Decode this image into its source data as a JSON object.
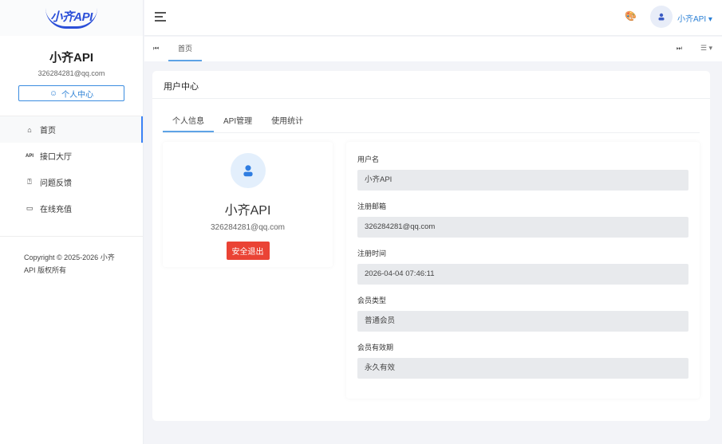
{
  "sidebar": {
    "logo_text": "小齐API",
    "name": "小齐API",
    "email": "326284281@qq.com",
    "profile_button": "个人中心",
    "menu": [
      {
        "label": "首页",
        "icon": "home-icon"
      },
      {
        "label": "接口大厅",
        "icon": "api-icon",
        "icon_text": "API"
      },
      {
        "label": "问题反馈",
        "icon": "feedback-icon"
      },
      {
        "label": "在线充值",
        "icon": "credit-card-icon"
      }
    ],
    "copyright": "Copyright © 2025-2026 小齐API 版权所有"
  },
  "header": {
    "username": "小齐API"
  },
  "tabbar": {
    "tabs": [
      "首页"
    ]
  },
  "card": {
    "title": "用户中心",
    "tabs": [
      "个人信息",
      "API管理",
      "使用统计"
    ],
    "profile": {
      "name": "小齐API",
      "email": "326284281@qq.com",
      "logout": "安全退出"
    },
    "fields": [
      {
        "label": "用户名",
        "value": "小齐API"
      },
      {
        "label": "注册邮箱",
        "value": "326284281@qq.com"
      },
      {
        "label": "注册时间",
        "value": "2026-04-04 07:46:11"
      },
      {
        "label": "会员类型",
        "value": "普通会员"
      },
      {
        "label": "会员有效期",
        "value": "永久有效"
      }
    ]
  },
  "colors": {
    "accent": "#2a7fd5",
    "danger": "#ea4335"
  }
}
